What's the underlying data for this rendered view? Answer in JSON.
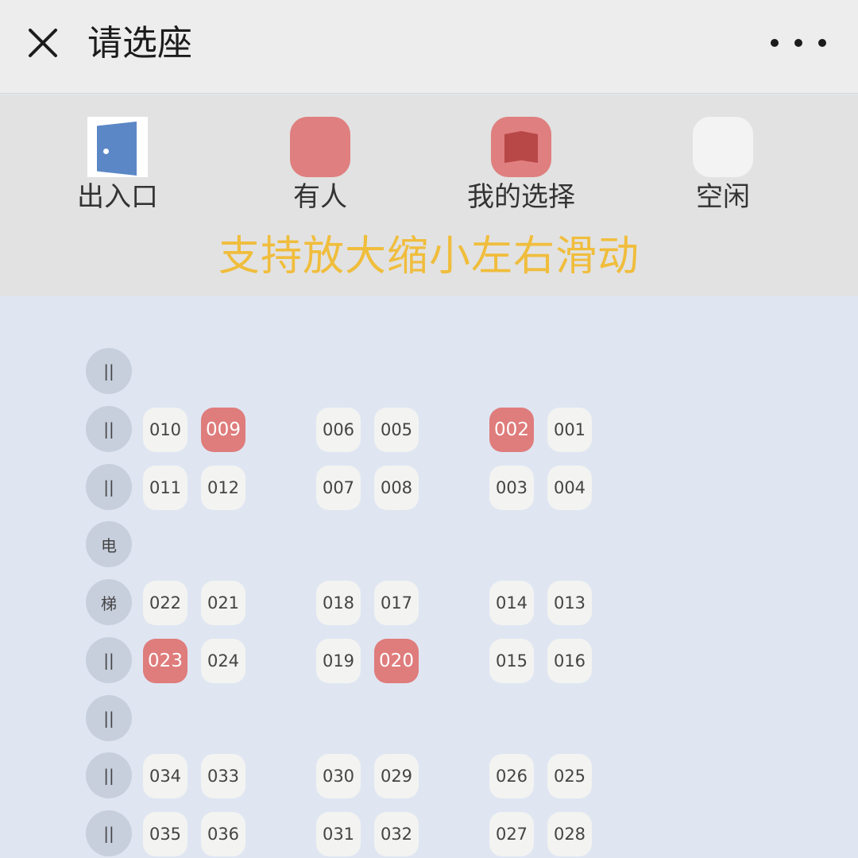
{
  "header": {
    "title": "请选座",
    "close_icon": "close-icon",
    "more_icon": "more-dots-icon"
  },
  "legend": {
    "items": [
      {
        "label": "出入口",
        "icon": "door-icon",
        "color": "#5b87c6"
      },
      {
        "label": "有人",
        "icon": "occupied-seat-icon",
        "color": "#e07f7f"
      },
      {
        "label": "我的选择",
        "icon": "my-selection-book-icon",
        "color": "#e07f7f"
      },
      {
        "label": "空闲",
        "icon": "free-seat-icon",
        "color": "#f3f3f3"
      }
    ],
    "hint": "支持放大缩小左右滑动",
    "hint_color": "#f0bd3c"
  },
  "seatmap": {
    "rows": [
      {
        "marker": "||",
        "seats": []
      },
      {
        "marker": "||",
        "seats": [
          {
            "id": "010",
            "status": "free"
          },
          {
            "id": "009",
            "status": "occupied"
          },
          {
            "id": "006",
            "status": "free"
          },
          {
            "id": "005",
            "status": "free"
          },
          {
            "id": "002",
            "status": "occupied"
          },
          {
            "id": "001",
            "status": "free"
          }
        ]
      },
      {
        "marker": "||",
        "seats": [
          {
            "id": "011",
            "status": "free"
          },
          {
            "id": "012",
            "status": "free"
          },
          {
            "id": "007",
            "status": "free"
          },
          {
            "id": "008",
            "status": "free"
          },
          {
            "id": "003",
            "status": "free"
          },
          {
            "id": "004",
            "status": "free"
          }
        ]
      },
      {
        "marker": "电",
        "seats": []
      },
      {
        "marker": "梯",
        "seats": [
          {
            "id": "022",
            "status": "free"
          },
          {
            "id": "021",
            "status": "free"
          },
          {
            "id": "018",
            "status": "free"
          },
          {
            "id": "017",
            "status": "free"
          },
          {
            "id": "014",
            "status": "free"
          },
          {
            "id": "013",
            "status": "free"
          }
        ]
      },
      {
        "marker": "||",
        "seats": [
          {
            "id": "023",
            "status": "occupied"
          },
          {
            "id": "024",
            "status": "free"
          },
          {
            "id": "019",
            "status": "free"
          },
          {
            "id": "020",
            "status": "occupied"
          },
          {
            "id": "015",
            "status": "free"
          },
          {
            "id": "016",
            "status": "free"
          }
        ]
      },
      {
        "marker": "||",
        "seats": []
      },
      {
        "marker": "||",
        "seats": [
          {
            "id": "034",
            "status": "free"
          },
          {
            "id": "033",
            "status": "free"
          },
          {
            "id": "030",
            "status": "free"
          },
          {
            "id": "029",
            "status": "free"
          },
          {
            "id": "026",
            "status": "free"
          },
          {
            "id": "025",
            "status": "free"
          }
        ]
      },
      {
        "marker": "||",
        "seats": [
          {
            "id": "035",
            "status": "free"
          },
          {
            "id": "036",
            "status": "free"
          },
          {
            "id": "031",
            "status": "free"
          },
          {
            "id": "032",
            "status": "free"
          },
          {
            "id": "027",
            "status": "free"
          },
          {
            "id": "028",
            "status": "free"
          }
        ]
      }
    ],
    "colors": {
      "occupied": "#df7c7c",
      "free": "#f3f3f1",
      "background": "#dfe6f2"
    }
  }
}
